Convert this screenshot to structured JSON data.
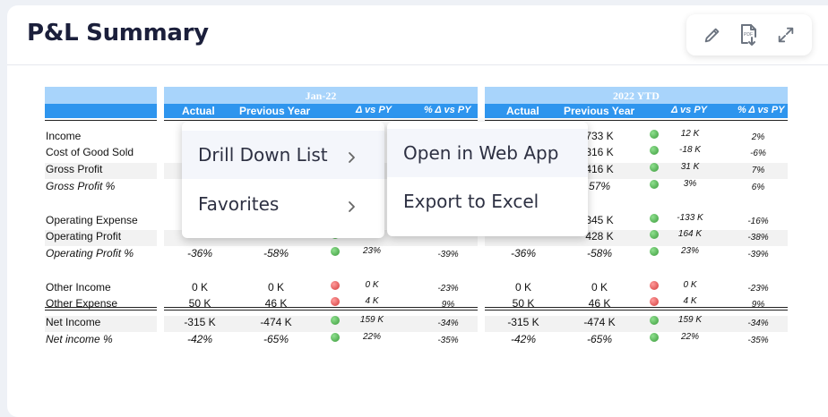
{
  "title": "P&L Summary",
  "toolbar": {
    "edit": "pencil-icon",
    "pdf": "pdf-export-icon",
    "expand": "expand-icon",
    "pdf_label": "PDF"
  },
  "sections": [
    {
      "title": "Jan-22",
      "cols": [
        "Actual",
        "Previous Year",
        "Δ vs PY",
        "% Δ vs PY"
      ]
    },
    {
      "title": "2022 YTD",
      "cols": [
        "Actual",
        "Previous Year",
        "Δ vs PY",
        "% Δ vs PY"
      ]
    }
  ],
  "rows": {
    "income": "Income",
    "cogs": "Cost of Good Sold",
    "gross": "Gross Profit",
    "grossp": "Gross Profit %",
    "opex": "Operating Expense",
    "opprofit": "Operating Profit",
    "opprofitp": "Operating Profit %",
    "othinc": "Other Income",
    "othexp": "Other Expense",
    "net": "Net Income",
    "netp": "Net income %"
  },
  "jan": {
    "income": [
      "",
      "",
      "",
      ""
    ],
    "cogs": [
      "",
      "",
      "",
      ""
    ],
    "gross": [
      "",
      "",
      "",
      ""
    ],
    "grossp": [
      "",
      "",
      "",
      ""
    ],
    "opex": [
      "",
      "",
      "",
      ""
    ],
    "opprofit": [
      "",
      "",
      "",
      ""
    ],
    "opprofitp": [
      "-36%",
      "-58%",
      "23%",
      "-39%"
    ],
    "othinc": [
      "0 K",
      "0 K",
      "0 K",
      "-23%"
    ],
    "othexp": [
      "50 K",
      "46 K",
      "4 K",
      "9%"
    ],
    "net": [
      "-315 K",
      "-474 K",
      "159 K",
      "-34%"
    ],
    "netp": [
      "-42%",
      "-65%",
      "22%",
      "-35%"
    ]
  },
  "ytd": {
    "income": [
      "",
      "733 K",
      "12 K",
      "2%"
    ],
    "cogs": [
      "",
      "316 K",
      "-18 K",
      "-6%"
    ],
    "gross": [
      "",
      "416 K",
      "31 K",
      "7%"
    ],
    "grossp": [
      "",
      "57%",
      "3%",
      "6%"
    ],
    "opex": [
      "",
      "345 K",
      "-133 K",
      "-16%"
    ],
    "opprofit": [
      "",
      "428 K",
      "164 K",
      "-38%"
    ],
    "opprofitp": [
      "-36%",
      "-58%",
      "23%",
      "-39%"
    ],
    "othinc": [
      "0 K",
      "0 K",
      "0 K",
      "-23%"
    ],
    "othexp": [
      "50 K",
      "46 K",
      "4 K",
      "9%"
    ],
    "net": [
      "-315 K",
      "-474 K",
      "159 K",
      "-34%"
    ],
    "netp": [
      "-42%",
      "-65%",
      "22%",
      "-35%"
    ]
  },
  "menu": {
    "items": [
      {
        "label": "Drill Down List"
      },
      {
        "label": "Favorites"
      }
    ],
    "submenu": [
      {
        "label": "Open in Web App"
      },
      {
        "label": "Export to Excel"
      }
    ]
  }
}
